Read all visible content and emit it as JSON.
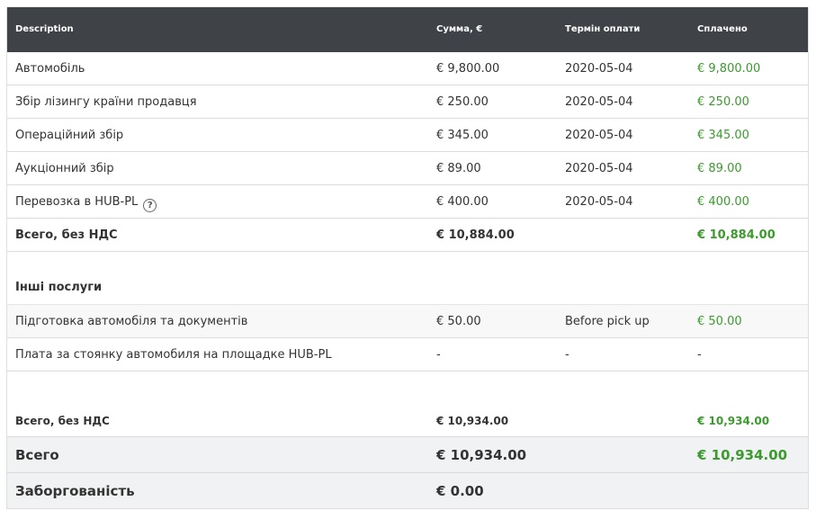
{
  "header": {
    "description": "Description",
    "amount": "Сумма, €",
    "due": "Термін оплати",
    "paid": "Сплачено"
  },
  "items": [
    {
      "desc": "Автомобіль",
      "amount": "€ 9,800.00",
      "due": "2020-05-04",
      "paid": "€ 9,800.00"
    },
    {
      "desc": "Збір лізингу країни продавця",
      "amount": "€ 250.00",
      "due": "2020-05-04",
      "paid": "€ 250.00"
    },
    {
      "desc": "Операційний збір",
      "amount": "€ 345.00",
      "due": "2020-05-04",
      "paid": "€ 345.00"
    },
    {
      "desc": "Аукціонний збір",
      "amount": "€ 89.00",
      "due": "2020-05-04",
      "paid": "€ 89.00"
    },
    {
      "desc": "Перевозка в HUB-PL",
      "amount": "€ 400.00",
      "due": "2020-05-04",
      "paid": "€ 400.00",
      "help_icon": "?"
    }
  ],
  "subtotal1": {
    "label": "Всего, без НДС",
    "amount": "€ 10,884.00",
    "paid": "€ 10,884.00"
  },
  "other_services": {
    "title": "Інші послуги",
    "items": [
      {
        "desc": "Підготовка автомобіля та документів",
        "amount": "€ 50.00",
        "due": "Before pick up",
        "paid": "€ 50.00"
      },
      {
        "desc": "Плата за стоянку автомобиля на площадке HUB-PL",
        "amount": "-",
        "due": "-",
        "paid": "-"
      }
    ]
  },
  "subtotal2": {
    "label": "Всего, без НДС",
    "amount": "€ 10,934.00",
    "paid": "€ 10,934.00"
  },
  "total": {
    "label": "Всего",
    "amount": "€ 10,934.00",
    "paid": "€ 10,934.00"
  },
  "debt": {
    "label": "Заборгованість",
    "amount": "€ 0.00"
  },
  "colors": {
    "header_bg": "#3f4246",
    "paid_green": "#3c9a2e",
    "grand_bg": "#f1f2f3"
  }
}
